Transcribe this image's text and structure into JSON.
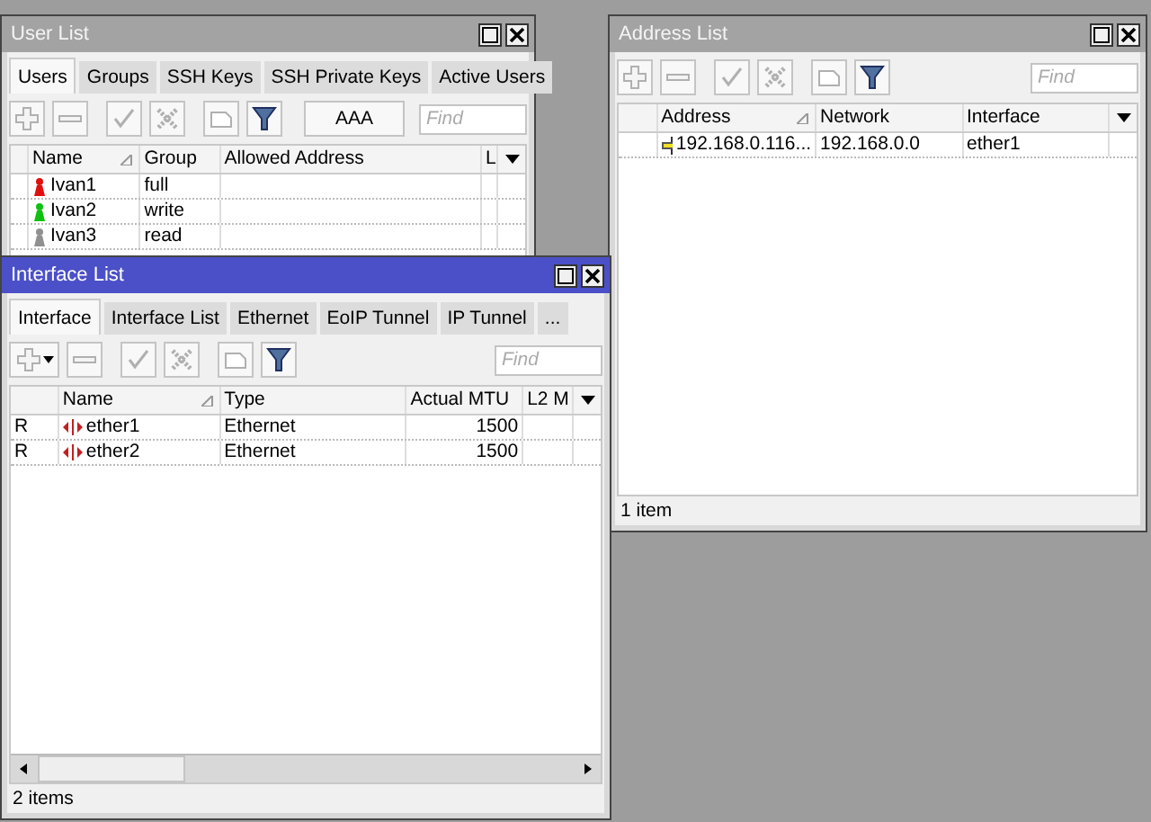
{
  "windows": [
    {
      "kind": "users",
      "title": "User List",
      "active": false,
      "tabs": [
        {
          "label": "Users",
          "selected": true
        },
        {
          "label": "Groups",
          "selected": false
        },
        {
          "label": "SSH Keys",
          "selected": false
        },
        {
          "label": "SSH Private Keys",
          "selected": false
        },
        {
          "label": "Active Users",
          "selected": false
        }
      ],
      "toolbar": [
        {
          "kind": "add",
          "disabled": true
        },
        {
          "kind": "remove",
          "disabled": true
        },
        {
          "kind": "enable",
          "disabled": true
        },
        {
          "kind": "disable",
          "disabled": true
        },
        {
          "kind": "comment",
          "disabled": true
        },
        {
          "kind": "filter",
          "disabled": false
        },
        {
          "kind": "text",
          "label": "AAA",
          "disabled": false
        }
      ],
      "find": {
        "placeholder": "Find"
      },
      "columns": [
        {
          "label": "Name",
          "sorted": true
        },
        {
          "label": "Group",
          "sorted": false
        },
        {
          "label": "Allowed Address",
          "sorted": false
        },
        {
          "label": "L",
          "sorted": false
        }
      ],
      "rows": [
        {
          "color": "#e01010",
          "cells": [
            "Ivan1",
            "full",
            "",
            ""
          ]
        },
        {
          "color": "#10c010",
          "cells": [
            "Ivan2",
            "write",
            "",
            ""
          ]
        },
        {
          "color": "#909090",
          "cells": [
            "Ivan3",
            "read",
            "",
            ""
          ]
        }
      ]
    },
    {
      "kind": "addresses",
      "title": "Address List",
      "active": false,
      "toolbar": [
        {
          "kind": "add",
          "disabled": true
        },
        {
          "kind": "remove",
          "disabled": true
        },
        {
          "kind": "enable",
          "disabled": true
        },
        {
          "kind": "disable",
          "disabled": true
        },
        {
          "kind": "comment",
          "disabled": true
        },
        {
          "kind": "filter",
          "disabled": false
        }
      ],
      "find": {
        "placeholder": "Find"
      },
      "columns": [
        {
          "label": "Address",
          "sorted": true
        },
        {
          "label": "Network",
          "sorted": false
        },
        {
          "label": "Interface",
          "sorted": false
        }
      ],
      "rows": [
        {
          "cells": [
            "192.168.0.116...",
            "192.168.0.0",
            "ether1"
          ]
        }
      ],
      "status": "1 item"
    },
    {
      "kind": "interfaces",
      "title": "Interface List",
      "active": true,
      "tabs": [
        {
          "label": "Interface",
          "selected": true
        },
        {
          "label": "Interface List",
          "selected": false
        },
        {
          "label": "Ethernet",
          "selected": false
        },
        {
          "label": "EoIP Tunnel",
          "selected": false
        },
        {
          "label": "IP Tunnel",
          "selected": false
        },
        {
          "label": "...",
          "selected": false
        }
      ],
      "toolbar": [
        {
          "kind": "add",
          "disabled": true,
          "dropdown": true
        },
        {
          "kind": "remove",
          "disabled": true
        },
        {
          "kind": "enable",
          "disabled": true
        },
        {
          "kind": "disable",
          "disabled": true
        },
        {
          "kind": "comment",
          "disabled": true
        },
        {
          "kind": "filter",
          "disabled": false
        }
      ],
      "find": {
        "placeholder": "Find"
      },
      "columns": [
        {
          "label": "Name",
          "sorted": true
        },
        {
          "label": "Type",
          "sorted": false
        },
        {
          "label": "Actual MTU",
          "sorted": false
        },
        {
          "label": "L2 M",
          "sorted": false
        }
      ],
      "rows": [
        {
          "flag": "R",
          "cells": [
            "ether1",
            "Ethernet",
            "1500",
            ""
          ]
        },
        {
          "flag": "R",
          "cells": [
            "ether2",
            "Ethernet",
            "1500",
            ""
          ]
        }
      ],
      "scrollbar": true,
      "status": "2 items"
    }
  ]
}
